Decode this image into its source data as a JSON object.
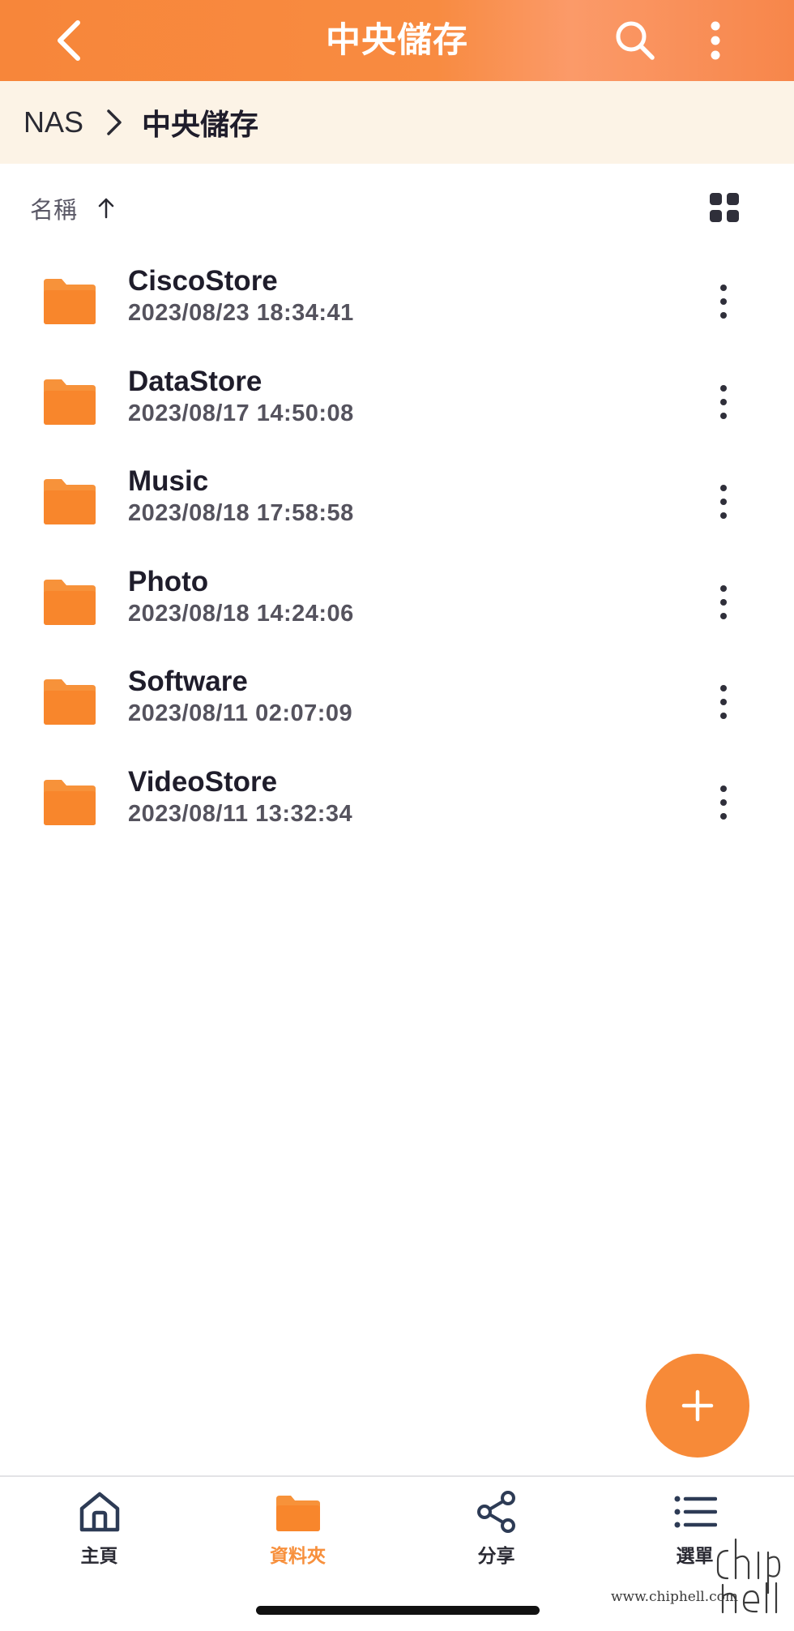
{
  "header": {
    "title": "中央儲存",
    "back_icon": "chevron-left-icon",
    "search_icon": "search-icon",
    "more_icon": "more-vertical-icon",
    "accent_color": "#f7863a"
  },
  "breadcrumb": {
    "root": "NAS",
    "separator_icon": "chevron-right-icon",
    "current": "中央儲存",
    "background": "#fcf3e6"
  },
  "sort": {
    "label": "名稱",
    "direction_icon": "arrow-up-icon",
    "view_toggle_icon": "grid-view-icon"
  },
  "files": [
    {
      "name": "CiscoStore",
      "modified": "2023/08/23 18:34:41"
    },
    {
      "name": "DataStore",
      "modified": "2023/08/17 14:50:08"
    },
    {
      "name": "Music",
      "modified": "2023/08/18 17:58:58"
    },
    {
      "name": "Photo",
      "modified": "2023/08/18 14:24:06"
    },
    {
      "name": "Software",
      "modified": "2023/08/11 02:07:09"
    },
    {
      "name": "VideoStore",
      "modified": "2023/08/11 13:32:34"
    }
  ],
  "fab": {
    "icon": "plus-icon",
    "color": "#f78a38"
  },
  "bottom_nav": {
    "items": [
      {
        "label": "主頁",
        "icon": "home-icon",
        "active": false
      },
      {
        "label": "資料夾",
        "icon": "folder-icon",
        "active": true
      },
      {
        "label": "分享",
        "icon": "share-icon",
        "active": false
      },
      {
        "label": "選單",
        "icon": "menu-list-icon",
        "active": false
      }
    ],
    "active_color": "#f7903d"
  },
  "watermark": {
    "url": "www.chiphell.com",
    "logo_text": "chip hell"
  }
}
